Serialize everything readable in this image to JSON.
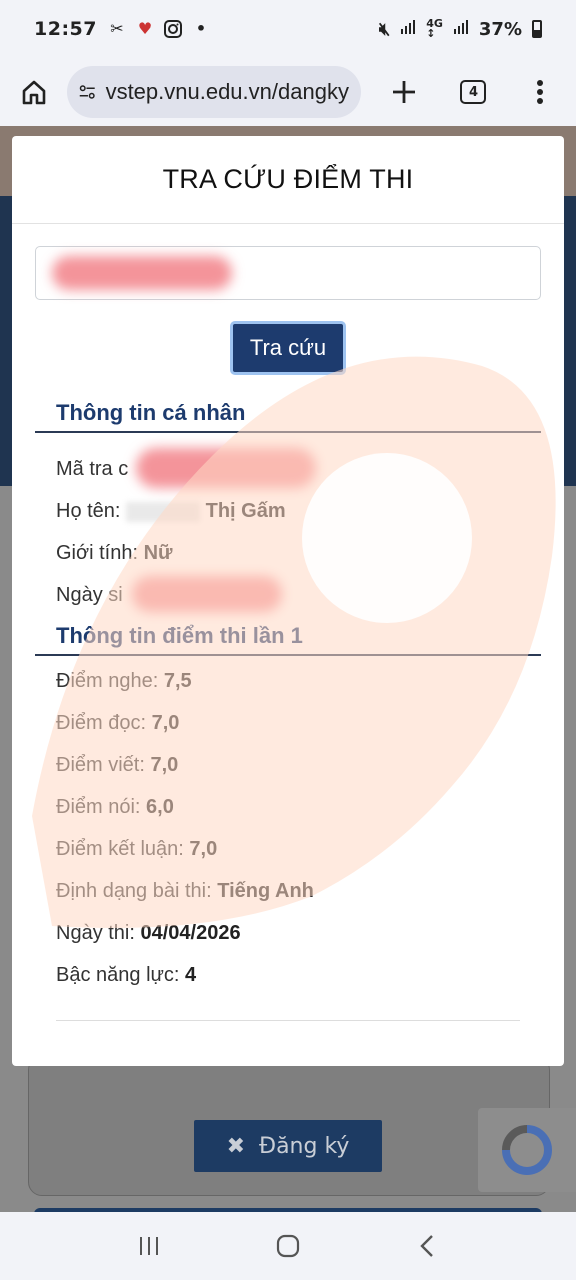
{
  "status_bar": {
    "time": "12:57",
    "battery": "37%",
    "icons": [
      "capcut-icon",
      "app-notification-icon",
      "instagram-icon",
      "dot-icon",
      "mute-icon",
      "signal-icon",
      "4g-signal-icon",
      "battery-icon"
    ]
  },
  "browser": {
    "url": "vstep.vnu.edu.vn/dangky",
    "tab_count": "4"
  },
  "modal": {
    "title": "TRA CỨU ĐIỂM THI",
    "search_value": "",
    "lookup_label": "Tra cứu",
    "personal": {
      "title": "Thông tin cá nhân",
      "lookup_code_label": "Mã tra c",
      "name_label": "Họ tên:",
      "name_value": "Thị Gấm",
      "gender_label": "Giới tính:",
      "gender_value": "Nữ",
      "dob_label": "Ngày si"
    },
    "scores": {
      "title": "Thông tin điểm thi lần 1",
      "rows": [
        {
          "label": "Điểm nghe:",
          "value": "7,5"
        },
        {
          "label": "Điểm đọc:",
          "value": "7,0"
        },
        {
          "label": "Điểm viết:",
          "value": "7,0"
        },
        {
          "label": "Điểm nói:",
          "value": "6,0"
        },
        {
          "label": "Điểm kết luận:",
          "value": "7,0"
        },
        {
          "label": "Định dạng bài thi:",
          "value": "Tiếng Anh"
        },
        {
          "label": "Ngày thi:",
          "value": "04/04/2026"
        },
        {
          "label": "Bậc năng lực:",
          "value": "4"
        }
      ]
    }
  },
  "page": {
    "register_label": "Đăng ký"
  },
  "colors": {
    "primary": "#1d3b6e",
    "watermark": "#ffd9c4"
  }
}
